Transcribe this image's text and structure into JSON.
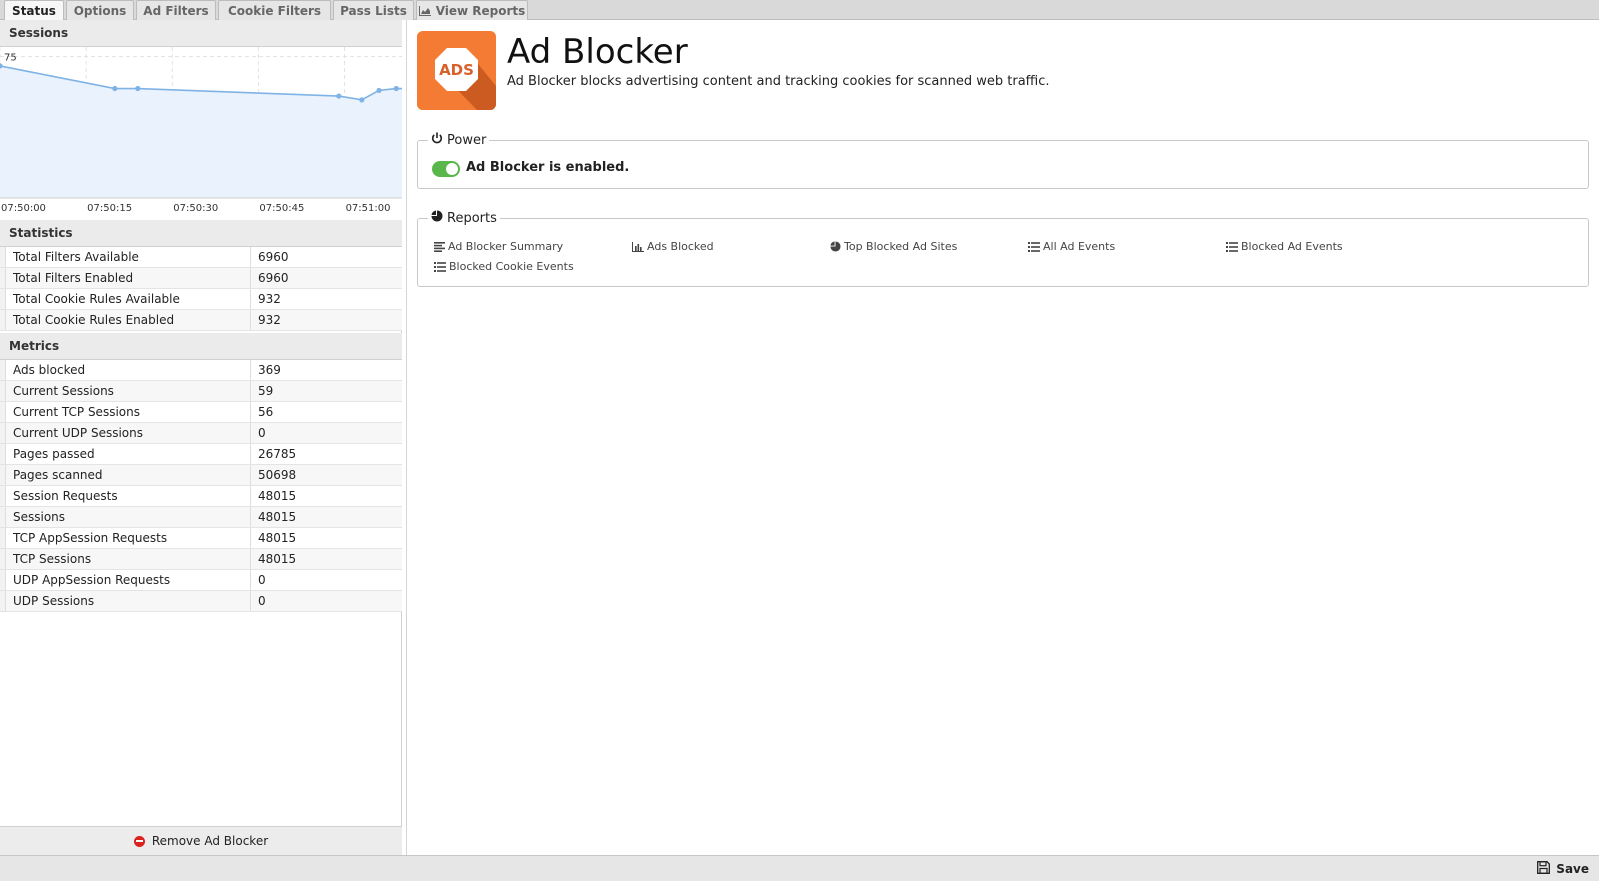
{
  "tabs": [
    {
      "label": "Status",
      "active": true
    },
    {
      "label": "Options"
    },
    {
      "label": "Ad Filters"
    },
    {
      "label": "Cookie Filters"
    },
    {
      "label": "Pass Lists"
    },
    {
      "label": "View Reports",
      "icon": "area-chart-icon"
    }
  ],
  "sessions": {
    "header": "Sessions",
    "chart_data": {
      "type": "area",
      "x": [
        "07:50:00",
        "07:50:20",
        "07:50:24",
        "07:50:59",
        "07:51:03",
        "07:51:06",
        "07:51:09"
      ],
      "values": [
        70,
        58,
        58,
        54,
        52,
        57,
        58
      ],
      "ylim": [
        0,
        80
      ],
      "yticks": [
        25,
        50,
        75
      ],
      "xticks": [
        "07:50:00",
        "07:50:15",
        "07:50:30",
        "07:50:45",
        "07:51:00"
      ],
      "xrange": [
        "07:50:00",
        "07:51:10"
      ],
      "grid": true,
      "line_color": "#7fb3e6",
      "fill_color": "#eaf3fd"
    }
  },
  "statistics": {
    "header": "Statistics",
    "rows": [
      {
        "key": "Total Filters Available",
        "value": "6960"
      },
      {
        "key": "Total Filters Enabled",
        "value": "6960"
      },
      {
        "key": "Total Cookie Rules Available",
        "value": "932"
      },
      {
        "key": "Total Cookie Rules Enabled",
        "value": "932"
      }
    ]
  },
  "metrics": {
    "header": "Metrics",
    "rows": [
      {
        "key": "Ads blocked",
        "value": "369"
      },
      {
        "key": "Current Sessions",
        "value": "59"
      },
      {
        "key": "Current TCP Sessions",
        "value": "56"
      },
      {
        "key": "Current UDP Sessions",
        "value": "0"
      },
      {
        "key": "Pages passed",
        "value": "26785"
      },
      {
        "key": "Pages scanned",
        "value": "50698"
      },
      {
        "key": "Session Requests",
        "value": "48015"
      },
      {
        "key": "Sessions",
        "value": "48015"
      },
      {
        "key": "TCP AppSession Requests",
        "value": "48015"
      },
      {
        "key": "TCP Sessions",
        "value": "48015"
      },
      {
        "key": "UDP AppSession Requests",
        "value": "0"
      },
      {
        "key": "UDP Sessions",
        "value": "0"
      }
    ]
  },
  "remove_label": "Remove Ad Blocker",
  "app": {
    "logo_text": "ADS",
    "title": "Ad Blocker",
    "description": "Ad Blocker blocks advertising content and tracking cookies for scanned web traffic.",
    "brand_color": "#f47b33"
  },
  "power": {
    "legend": "Power",
    "status_text": "Ad Blocker is enabled.",
    "enabled": true
  },
  "reports": {
    "legend": "Reports",
    "links": [
      {
        "label": "Ad Blocker Summary",
        "icon": "align-left-icon"
      },
      {
        "label": "Ads Blocked",
        "icon": "bar-chart-icon"
      },
      {
        "label": "Top Blocked Ad Sites",
        "icon": "pie-chart-icon"
      },
      {
        "label": "All Ad Events",
        "icon": "list-icon"
      },
      {
        "label": "Blocked Ad Events",
        "icon": "list-icon"
      },
      {
        "label": "Blocked Cookie Events",
        "icon": "list-icon"
      }
    ]
  },
  "save_label": "Save"
}
